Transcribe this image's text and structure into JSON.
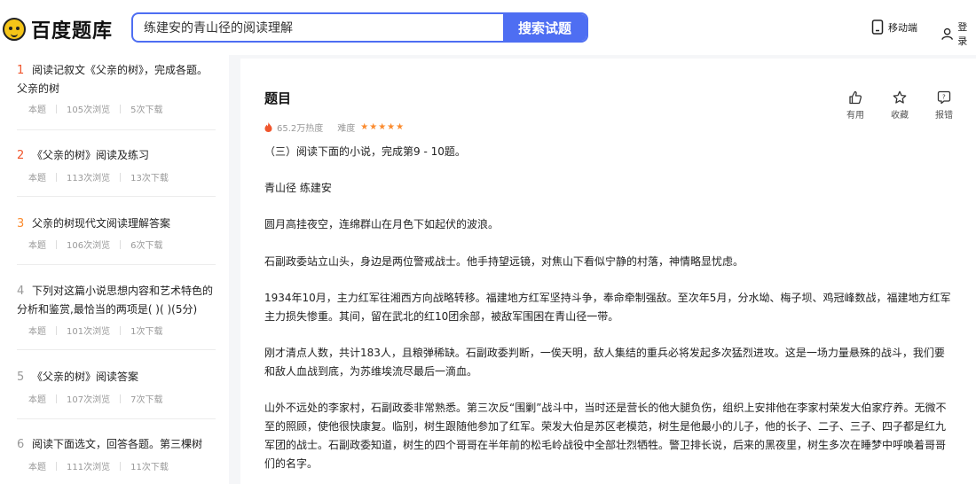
{
  "header": {
    "logo_text": "百度题库",
    "search_value": "练建安的青山径的阅读理解",
    "search_button": "搜索试题",
    "mobile_label": "移动端",
    "login_label": "登录"
  },
  "list": [
    {
      "num": "1",
      "title": "阅读记叙文《父亲的树》，完成各题。父亲的树",
      "type": "本题",
      "views": "105次浏览",
      "downloads": "5次下载"
    },
    {
      "num": "2",
      "title": "《父亲的树》阅读及练习",
      "type": "本题",
      "views": "113次浏览",
      "downloads": "13次下载"
    },
    {
      "num": "3",
      "title": "父亲的树现代文阅读理解答案",
      "type": "本题",
      "views": "106次浏览",
      "downloads": "6次下载"
    },
    {
      "num": "4",
      "title": "下列对这篇小说思想内容和艺术特色的分析和鉴赏,最恰当的两项是( )( )(5分)",
      "type": "本题",
      "views": "101次浏览",
      "downloads": "1次下载"
    },
    {
      "num": "5",
      "title": "《父亲的树》阅读答案",
      "type": "本题",
      "views": "107次浏览",
      "downloads": "7次下载"
    },
    {
      "num": "6",
      "title": "阅读下面选文，回答各题。第三棵树",
      "type": "本题",
      "views": "111次浏览",
      "downloads": "11次下载"
    }
  ],
  "main": {
    "title": "题目",
    "heat": "65.2万热度",
    "difficulty_label": "难度",
    "difficulty_stars": 5,
    "actions": {
      "useful": "有用",
      "collect": "收藏",
      "report": "报错"
    },
    "paragraphs": [
      "（三）阅读下面的小说，完成第9 - 10题。",
      "青山径 练建安",
      "圆月高挂夜空，连绵群山在月色下如起伏的波浪。",
      "石副政委站立山头，身边是两位警戒战士。他手持望远镜，对焦山下看似宁静的村落，神情略显忧虑。",
      "1934年10月，主力红军往湘西方向战略转移。福建地方红军坚持斗争，奉命牵制强敌。至次年5月，分水坳、梅子坝、鸡冠峰数战，福建地方红军主力损失惨重。其间，留在武北的红10团余部，被敌军围困在青山径一带。",
      "刚才清点人数，共计183人，且粮弹稀缺。石副政委判断，一俟天明，敌人集结的重兵必将发起多次猛烈进攻。这是一场力量悬殊的战斗，我们要和敌人血战到底，为苏维埃流尽最后一滴血。",
      "山外不远处的李家村，石副政委非常熟悉。第三次反“围剿”战斗中，当时还是营长的他大腿负伤，组织上安排他在李家村荣发大伯家疗养。无微不至的照顾，使他很快康复。临别，树生跟随他参加了红军。荣发大伯是苏区老模范，树生是他最小的儿子，他的长子、二子、三子、四子都是红九军团的战士。石副政委知道，树生的四个哥哥在半年前的松毛岭战役中全部壮烈牺牲。警卫排长说，后来的黑夜里，树生多次在睡梦中呼唤着哥哥们的名字。"
    ]
  },
  "colors": {
    "accent": "#4e6ef2",
    "num_red": "#f0562d",
    "num_orange": "#fb8b2e",
    "heat": "#f0562d",
    "stars": "#fb8b2e"
  }
}
